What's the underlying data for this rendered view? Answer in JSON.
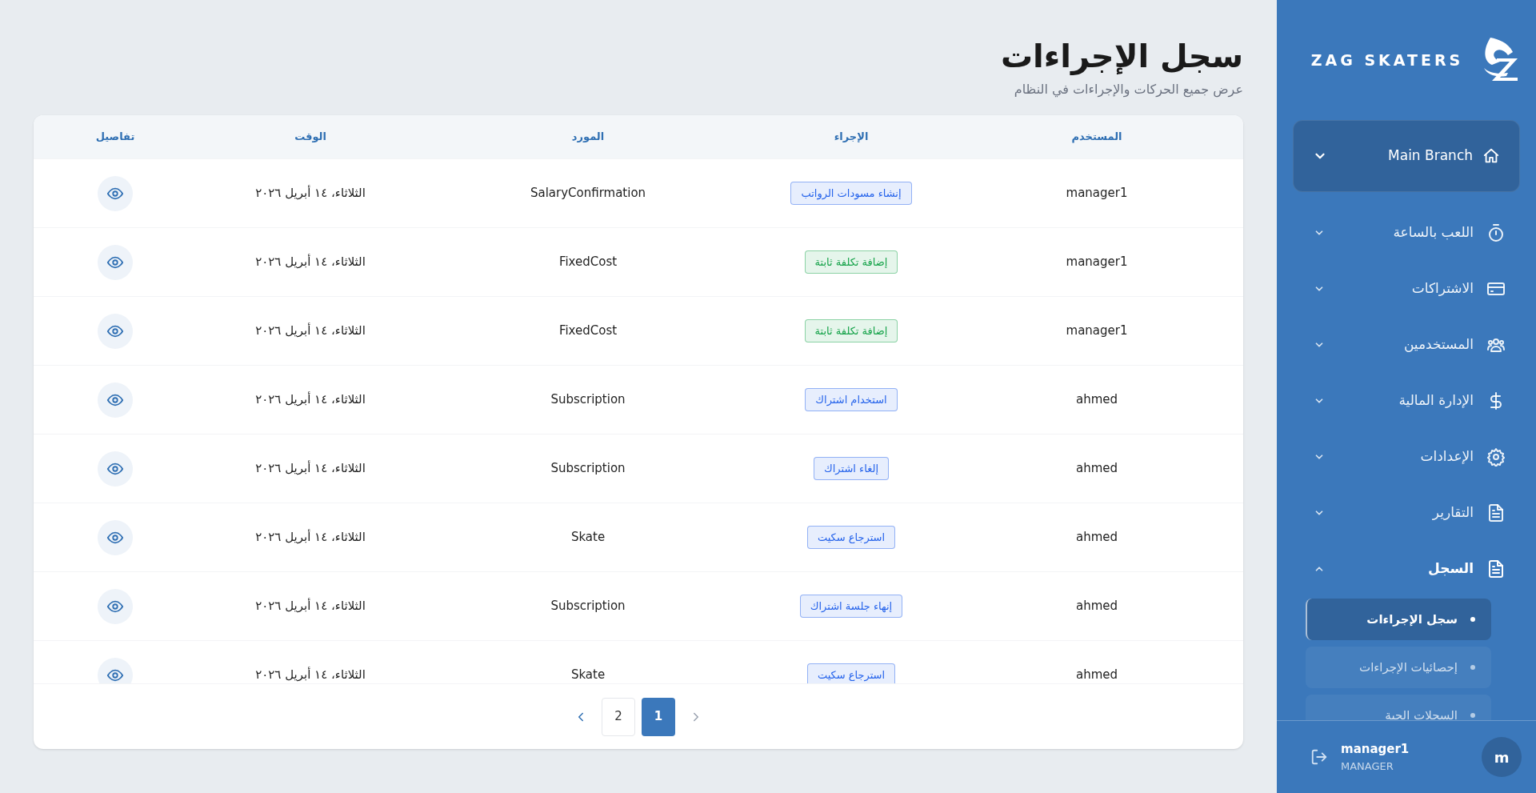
{
  "page": {
    "title": "سجل الإجراءات",
    "subtitle": "عرض جميع الحركات والإجراءات في النظام"
  },
  "table": {
    "columns": [
      "المستخدم",
      "الإجراء",
      "المورد",
      "الوقت",
      "تفاصيل"
    ],
    "rows": [
      {
        "user": "manager1",
        "action": {
          "label": "إنشاء مسودات الرواتب",
          "color": "#2563eb"
        },
        "resource": "SalaryConfirmation",
        "time": "الثلاثاء، ١٤ أبريل ٢٠٢٦"
      },
      {
        "user": "manager1",
        "action": {
          "label": "إضافة تكلفة ثابتة",
          "color": "#16a34a"
        },
        "resource": "FixedCost",
        "time": "الثلاثاء، ١٤ أبريل ٢٠٢٦"
      },
      {
        "user": "manager1",
        "action": {
          "label": "إضافة تكلفة ثابتة",
          "color": "#16a34a"
        },
        "resource": "FixedCost",
        "time": "الثلاثاء، ١٤ أبريل ٢٠٢٦"
      },
      {
        "user": "ahmed",
        "action": {
          "label": "استخدام اشتراك",
          "color": "#2563eb"
        },
        "resource": "Subscription",
        "time": "الثلاثاء، ١٤ أبريل ٢٠٢٦"
      },
      {
        "user": "ahmed",
        "action": {
          "label": "إلغاء اشتراك",
          "color": "#2563eb"
        },
        "resource": "Subscription",
        "time": "الثلاثاء، ١٤ أبريل ٢٠٢٦"
      },
      {
        "user": "ahmed",
        "action": {
          "label": "استرجاع سكيت",
          "color": "#2563eb"
        },
        "resource": "Skate",
        "time": "الثلاثاء، ١٤ أبريل ٢٠٢٦"
      },
      {
        "user": "ahmed",
        "action": {
          "label": "إنهاء جلسة اشتراك",
          "color": "#2563eb"
        },
        "resource": "Subscription",
        "time": "الثلاثاء، ١٤ أبريل ٢٠٢٦"
      },
      {
        "user": "ahmed",
        "action": {
          "label": "استرجاع سكيت",
          "color": "#2563eb"
        },
        "resource": "Skate",
        "time": "الثلاثاء، ١٤ أبريل ٢٠٢٦"
      }
    ]
  },
  "pagination": {
    "previous": {
      "disabled": true
    },
    "pages": [
      {
        "label": "1",
        "selected": true
      },
      {
        "label": "2",
        "selected": false
      }
    ],
    "next": {
      "disabled": false
    }
  },
  "sidebar": {
    "brand": "ZAG SKATERS",
    "branch": "Main Branch",
    "nav": [
      {
        "label": "اللعب بالساعة",
        "expanded": false
      },
      {
        "label": "الاشتراكات",
        "expanded": false
      },
      {
        "label": "المستخدمين",
        "expanded": false
      },
      {
        "label": "الإدارة المالية",
        "expanded": false
      },
      {
        "label": "الإعدادات",
        "expanded": false
      },
      {
        "label": "التقارير",
        "expanded": false
      },
      {
        "label": "السجل",
        "expanded": true,
        "children": [
          {
            "label": "سجل الإجراءات",
            "selected": true
          },
          {
            "label": "إحصائيات الإجراءات",
            "selected": false
          },
          {
            "label": "السجلات الحية",
            "selected": false
          }
        ]
      }
    ],
    "user": {
      "avatar": "m",
      "name": "manager1",
      "role": "MANAGER"
    }
  }
}
